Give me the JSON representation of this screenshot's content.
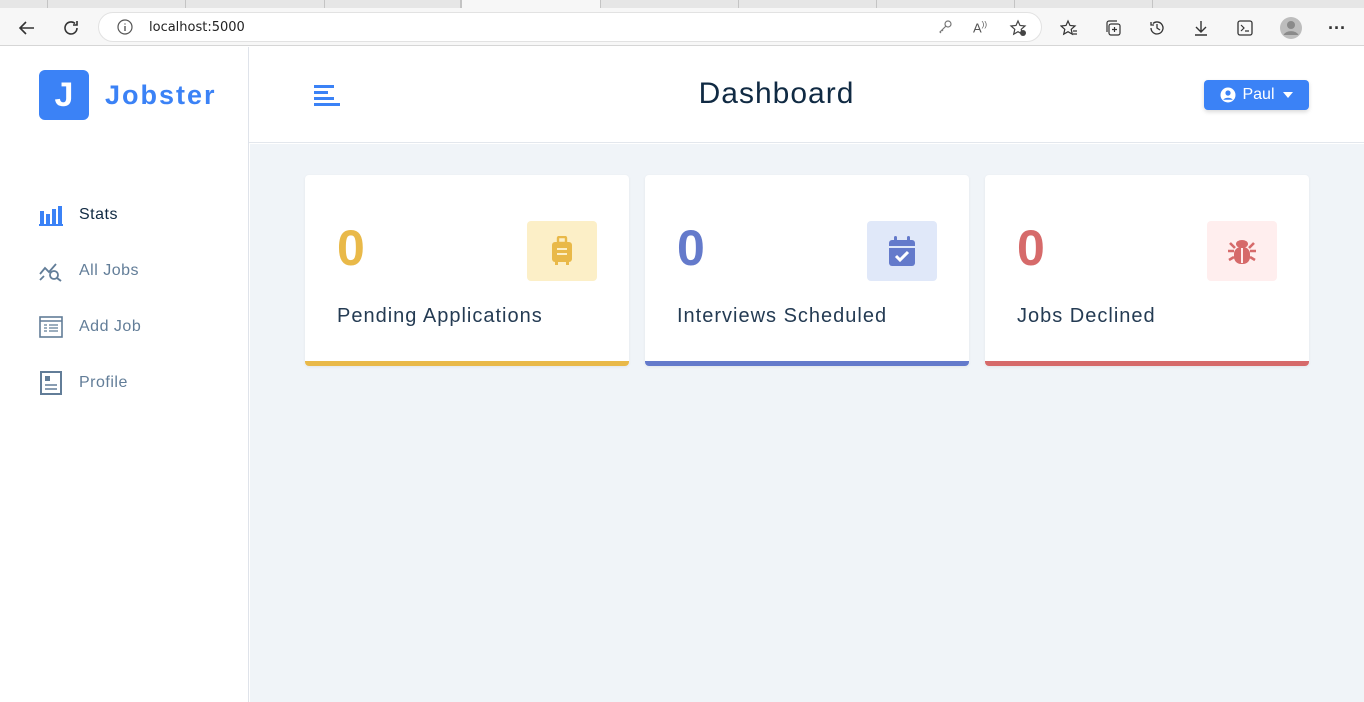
{
  "browser": {
    "url": "localhost:5000",
    "icons": [
      "back-icon",
      "refresh-icon",
      "info-icon",
      "key-icon",
      "read-aloud-icon",
      "add-favorite-icon",
      "favorites-icon",
      "collections-icon",
      "history-icon",
      "download-icon",
      "extensions-icon",
      "profile-icon",
      "more-icon"
    ]
  },
  "sidebar": {
    "logo_letter": "J",
    "logo_text": "Jobster",
    "items": [
      {
        "label": "Stats",
        "icon": "bar-chart-icon"
      },
      {
        "label": "All Jobs",
        "icon": "chart-search-icon"
      },
      {
        "label": "Add Job",
        "icon": "form-icon"
      },
      {
        "label": "Profile",
        "icon": "id-card-icon"
      }
    ]
  },
  "header": {
    "title": "Dashboard",
    "user": "Paul"
  },
  "stats": [
    {
      "count": "0",
      "label": "Pending Applications",
      "color": "#e9b949",
      "bg": "#fcefc7",
      "icon": "suitcase-icon"
    },
    {
      "count": "0",
      "label": "Interviews Scheduled",
      "color": "#647acb",
      "bg": "#e0e8f9",
      "icon": "calendar-check-icon"
    },
    {
      "count": "0",
      "label": "Jobs Declined",
      "color": "#d66a6a",
      "bg": "#ffeeee",
      "icon": "bug-icon"
    }
  ],
  "colors": {
    "primary": "#3b82f6",
    "background": "#f0f4f8"
  }
}
